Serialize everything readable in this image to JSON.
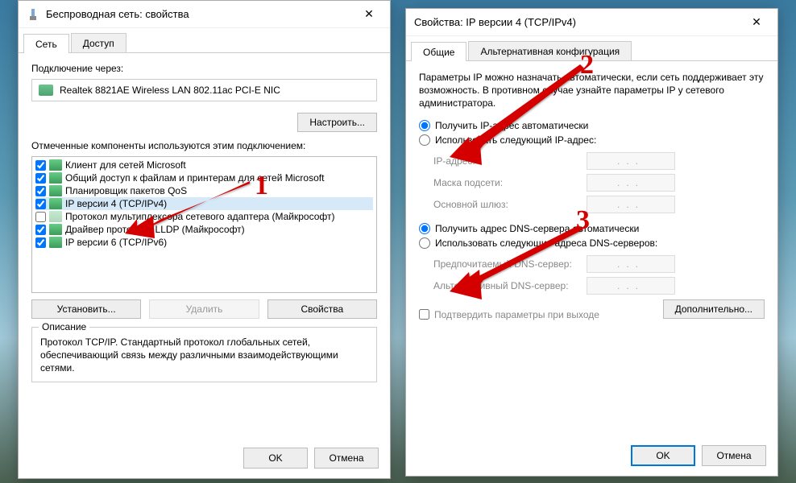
{
  "dialog1": {
    "title": "Беспроводная сеть: свойства",
    "tabs": [
      "Сеть",
      "Доступ"
    ],
    "activeTab": 0,
    "connectVia": "Подключение через:",
    "adapter": "Realtek 8821AE Wireless LAN 802.11ac PCI-E NIC",
    "configure": "Настроить...",
    "componentsLabel": "Отмеченные компоненты используются этим подключением:",
    "items": [
      {
        "checked": true,
        "label": "Клиент для сетей Microsoft"
      },
      {
        "checked": true,
        "label": "Общий доступ к файлам и принтерам для сетей Microsoft"
      },
      {
        "checked": true,
        "label": "Планировщик пакетов QoS"
      },
      {
        "checked": true,
        "label": "IP версии 4 (TCP/IPv4)",
        "selected": true
      },
      {
        "checked": false,
        "label": "Протокол мультиплексора сетевого адаптера (Майкрософт)"
      },
      {
        "checked": true,
        "label": "Драйвер протокола LLDP (Майкрософт)"
      },
      {
        "checked": true,
        "label": "IP версии 6 (TCP/IPv6)"
      }
    ],
    "install": "Установить...",
    "uninstall": "Удалить",
    "properties": "Свойства",
    "descTitle": "Описание",
    "descText": "Протокол TCP/IP. Стандартный протокол глобальных сетей, обеспечивающий связь между различными взаимодействующими сетями.",
    "ok": "OK",
    "cancel": "Отмена"
  },
  "dialog2": {
    "title": "Свойства: IP версии 4 (TCP/IPv4)",
    "tabs": [
      "Общие",
      "Альтернативная конфигурация"
    ],
    "activeTab": 0,
    "info": "Параметры IP можно назначать автоматически, если сеть поддерживает эту возможность. В противном случае узнайте параметры IP у сетевого администратора.",
    "ipAutoLabel": "Получить IP-адрес автоматически",
    "ipManualLabel": "Использовать следующий IP-адрес:",
    "ipFields": {
      "ip": "IP-адрес:",
      "mask": "Маска подсети:",
      "gateway": "Основной шлюз:"
    },
    "dnsAutoLabel": "Получить адрес DNS-сервера автоматически",
    "dnsManualLabel": "Использовать следующие адреса DNS-серверов:",
    "dnsFields": {
      "pref": "Предпочитаемый DNS-сервер:",
      "alt": "Альтернативный DNS-сервер:"
    },
    "confirmOnExit": "Подтвердить параметры при выходе",
    "advanced": "Дополнительно...",
    "ok": "OK",
    "cancel": "Отмена"
  },
  "annotations": {
    "num1": "1",
    "num2": "2",
    "num3": "3"
  }
}
